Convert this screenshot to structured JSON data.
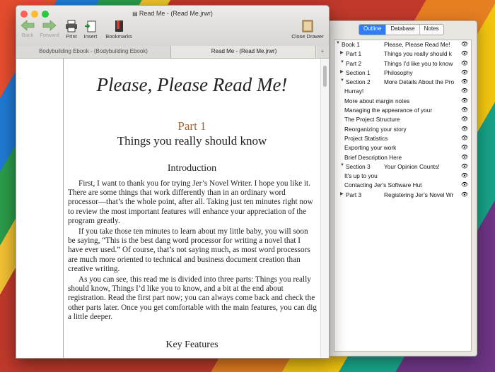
{
  "window": {
    "title": "Read Me - (Read Me.jrwr)",
    "toolbar": {
      "back": "Back",
      "forward": "Forward",
      "print": "Print",
      "insert": "Insert",
      "bookmarks": "Bookmarks",
      "close_drawer": "Close Drawer"
    },
    "tabs": [
      {
        "label": "Bodybuilding Ebook - (Bodybuilding Ebook)"
      },
      {
        "label": "Read Me - (Read Me.jrwr)"
      }
    ],
    "tab_add": "+"
  },
  "document": {
    "title": "Please, Please Read Me!",
    "part_number": "Part 1",
    "part_title": "Things you really should know",
    "section_heading": "Introduction",
    "paragraphs": [
      "First, I want to thank you for trying Jer’s Novel Writer. I hope you like it. There are some things that work differently than in an ordinary word processor—that’s the whole point, after all. Taking just ten minutes right now to review the most important features will enhance your appreciation of the program greatly.",
      "If you take those ten minutes to learn about my little baby, you will soon be saying, “This is the best dang word processor for writing a novel that I have ever used.” Of course, that’s not saying much, as most word processors are much more oriented to technical and business document creation than creative writing.",
      "As you can see, this read me is divided into three parts: Things you really should know, Things I’d like you to know, and a bit at the end about registration. Read the first part now; you can always come back and check the other parts later. Once you get comfortable with the main features, you can dig a little deeper."
    ],
    "next_heading": "Key Features"
  },
  "drawer": {
    "tabs": [
      "Outline",
      "Database",
      "Notes"
    ],
    "active_tab": "Outline",
    "outline": [
      {
        "level": 0,
        "tri": "down",
        "label": "Book 1",
        "title": "Please, Please Read Me!"
      },
      {
        "level": 1,
        "tri": "right",
        "label": "Part 1",
        "title": "Things you really should k"
      },
      {
        "level": 1,
        "tri": "down",
        "label": "Part 2",
        "title": "Things I’d like you to know"
      },
      {
        "level": 2,
        "tri": "right",
        "label": "Section 1",
        "title": "Philosophy"
      },
      {
        "level": 2,
        "tri": "down",
        "label": "Section 2",
        "title": "More Details About the Pro"
      },
      {
        "level": 3,
        "tri": "",
        "label": "Hurray!",
        "title": ""
      },
      {
        "level": 3,
        "tri": "",
        "label": "More about margin notes",
        "title": ""
      },
      {
        "level": 3,
        "tri": "",
        "label": "Managing the appearance of your",
        "title": ""
      },
      {
        "level": 3,
        "tri": "",
        "label": "The Project Structure",
        "title": ""
      },
      {
        "level": 3,
        "tri": "",
        "label": "Reorganizing your story",
        "title": ""
      },
      {
        "level": 3,
        "tri": "",
        "label": "Project Statistics",
        "title": ""
      },
      {
        "level": 3,
        "tri": "",
        "label": "Exporting your work",
        "title": ""
      },
      {
        "level": 3,
        "tri": "",
        "label": "Brief Description Here",
        "title": ""
      },
      {
        "level": 2,
        "tri": "down",
        "label": "Section 3",
        "title": "Your Opinion Counts!"
      },
      {
        "level": 3,
        "tri": "",
        "label": "It's up to you",
        "title": ""
      },
      {
        "level": 3,
        "tri": "",
        "label": "Contacting Jer's Software Hut",
        "title": ""
      },
      {
        "level": 1,
        "tri": "right",
        "label": "Part 3",
        "title": "Registering Jer’s Novel Wr"
      }
    ]
  },
  "colors": {
    "accent": "#2f7cf6",
    "part_color": "#a2653a",
    "close_light": "#fd5f57",
    "min_light": "#febb2e",
    "max_light": "#28c840",
    "nav_arrow": "#8dc07d"
  }
}
